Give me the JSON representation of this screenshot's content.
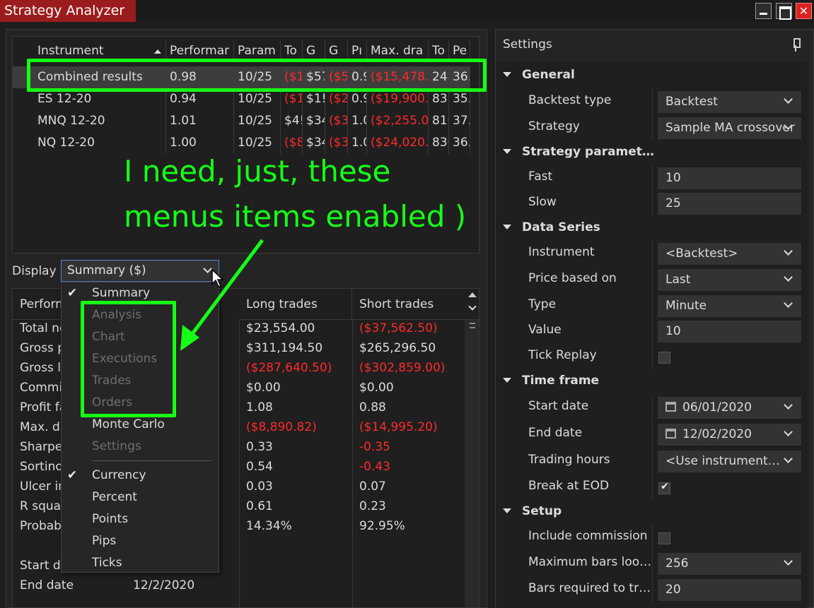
{
  "window": {
    "title": "Strategy Analyzer"
  },
  "results": {
    "columns": [
      "Instrument",
      "Performar",
      "Param",
      "To",
      "G",
      "G",
      "Pı",
      "Max. dra",
      "To",
      "Pe"
    ],
    "rows": [
      {
        "cells": [
          "Combined results",
          "0.98",
          "10/25",
          "($1",
          "$57",
          "($5",
          "0.9",
          "($15,478.",
          "248",
          "36."
        ]
      },
      {
        "cells": [
          "ES 12-20",
          "0.94",
          "10/25",
          "($1",
          "$1!",
          "($2",
          "0.9",
          "($19,900.",
          "837",
          "35."
        ]
      },
      {
        "cells": [
          "MNQ 12-20",
          "1.01",
          "10/25",
          "$4!",
          "$34",
          "($3",
          "1.0",
          "($2,255.0",
          "816",
          "37."
        ]
      },
      {
        "cells": [
          "NQ 12-20",
          "1.00",
          "10/25",
          "($8",
          "$34",
          "($3",
          "1.0",
          "($24,020.",
          "830",
          "36."
        ]
      }
    ]
  },
  "display": {
    "label": "Display",
    "value": "Summary ($)"
  },
  "summary": {
    "columns": [
      "Perform",
      "Long trades",
      "Short trades"
    ],
    "rows": [
      {
        "label": "Total ne",
        "long": "$23,554.00",
        "short": "($37,562.50)"
      },
      {
        "label": "Gross p",
        "long": "$311,194.50",
        "short": "$265,296.50"
      },
      {
        "label": "Gross l",
        "long": "($287,640.50)",
        "short": "($302,859.00)"
      },
      {
        "label": "Commis",
        "long": "$0.00",
        "short": "$0.00"
      },
      {
        "label": "Profit fa",
        "long": "1.08",
        "short": "0.88"
      },
      {
        "label": "Max. dr",
        "long": "($8,890.82)",
        "short": "($14,995.20)"
      },
      {
        "label": "Sharpe",
        "long": "0.33",
        "short": "-0.35"
      },
      {
        "label": "Sortino",
        "long": "0.54",
        "short": "-0.43"
      },
      {
        "label": "Ulcer in",
        "long": "0.03",
        "short": "0.07"
      },
      {
        "label": "R squa",
        "long": "0.61",
        "short": "0.23"
      },
      {
        "label": "Probab",
        "long": "14.34%",
        "short": "92.95%"
      }
    ],
    "start_label": "Start da",
    "end_label": "End date",
    "end_value": "12/2/2020"
  },
  "menu": {
    "items": [
      {
        "label": "Summary",
        "checked": true,
        "enabled": true
      },
      {
        "label": "Analysis",
        "checked": false,
        "enabled": false
      },
      {
        "label": "Chart",
        "checked": false,
        "enabled": false
      },
      {
        "label": "Executions",
        "checked": false,
        "enabled": false
      },
      {
        "label": "Trades",
        "checked": false,
        "enabled": false
      },
      {
        "label": "Orders",
        "checked": false,
        "enabled": false
      },
      {
        "label": "Monte Carlo",
        "checked": false,
        "enabled": true
      },
      {
        "label": "Settings",
        "checked": false,
        "enabled": false
      },
      {
        "label": "Currency",
        "checked": true,
        "enabled": true
      },
      {
        "label": "Percent",
        "checked": false,
        "enabled": true
      },
      {
        "label": "Points",
        "checked": false,
        "enabled": true
      },
      {
        "label": "Pips",
        "checked": false,
        "enabled": true
      },
      {
        "label": "Ticks",
        "checked": false,
        "enabled": true
      }
    ]
  },
  "annotation": {
    "line1": "I need, just, these",
    "line2": "menus items enabled )",
    "color": "#16ff16"
  },
  "settings": {
    "title": "Settings",
    "general": {
      "label": "General",
      "backtest_type_label": "Backtest type",
      "backtest_type": "Backtest",
      "strategy_label": "Strategy",
      "strategy": "Sample MA crossover"
    },
    "params": {
      "label": "Strategy paramet…",
      "fast_label": "Fast",
      "fast": "10",
      "slow_label": "Slow",
      "slow": "25"
    },
    "data_series": {
      "label": "Data Series",
      "instrument_label": "Instrument",
      "instrument": "<Backtest>",
      "price_label": "Price based on",
      "price": "Last",
      "type_label": "Type",
      "type": "Minute",
      "value_label": "Value",
      "value": "10",
      "tick_replay_label": "Tick Replay"
    },
    "time_frame": {
      "label": "Time frame",
      "start_label": "Start date",
      "start": "06/01/2020",
      "end_label": "End date",
      "end": "12/02/2020",
      "hours_label": "Trading hours",
      "hours": "<Use instrument…",
      "eod_label": "Break at EOD"
    },
    "setup": {
      "label": "Setup",
      "commission_label": "Include commission",
      "max_bars_label": "Maximum bars loo…",
      "max_bars": "256",
      "bars_req_label": "Bars required to tr…",
      "bars_req": "20"
    }
  }
}
